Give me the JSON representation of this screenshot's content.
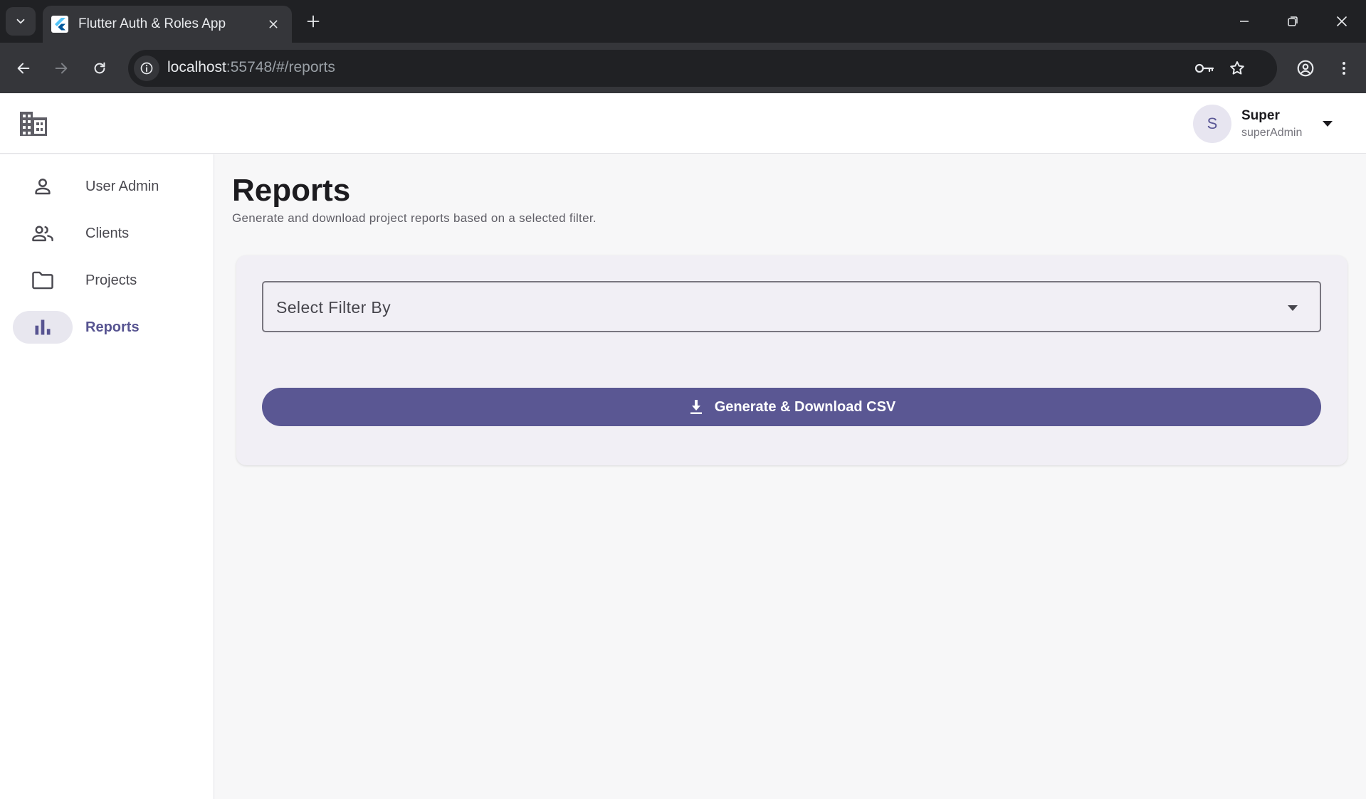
{
  "browser": {
    "tab_title": "Flutter Auth & Roles App",
    "url_host": "localhost",
    "url_path": ":55748/#/reports"
  },
  "user": {
    "initial": "S",
    "name": "Super",
    "role": "superAdmin"
  },
  "sidebar": {
    "items": [
      {
        "label": "User Admin",
        "icon": "person-icon",
        "active": false
      },
      {
        "label": "Clients",
        "icon": "people-icon",
        "active": false
      },
      {
        "label": "Projects",
        "icon": "folder-icon",
        "active": false
      },
      {
        "label": "Reports",
        "icon": "bar-chart-icon",
        "active": true
      }
    ]
  },
  "page": {
    "title": "Reports",
    "subtitle": "Generate and download project reports based on a selected filter."
  },
  "report_form": {
    "filter_placeholder": "Select Filter By",
    "generate_button_label": "Generate & Download CSV"
  },
  "colors": {
    "primary": "#5a5793",
    "active_nav_bg": "#e8e7ef",
    "card_bg": "#f1eff5",
    "browser_dark": "#202124"
  }
}
